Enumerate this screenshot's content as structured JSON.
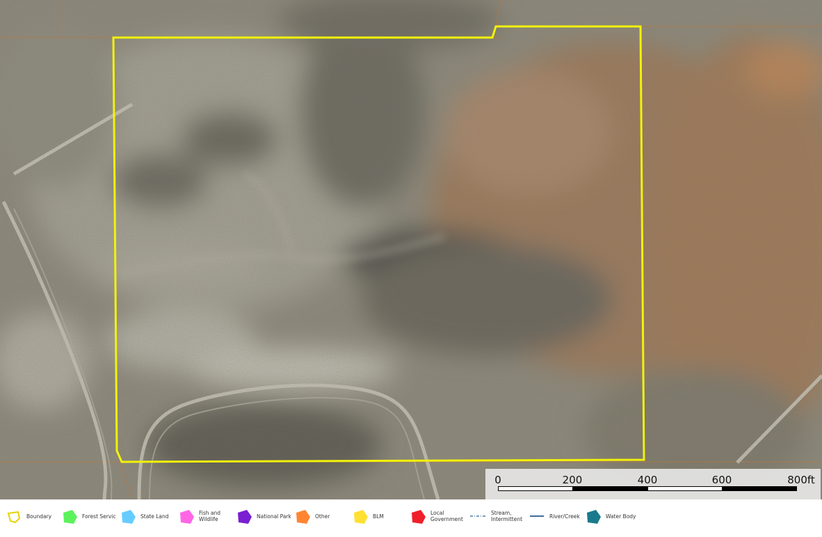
{
  "map": {
    "boundary_color": "#f2f20a",
    "parcel_line_color": "#c0793c"
  },
  "scale_bar": {
    "labels": [
      "0",
      "200",
      "400",
      "600",
      "800ft"
    ]
  },
  "legend": {
    "items": [
      {
        "label": "Boundary",
        "color": "#ffff00",
        "icon": "boundary-outline-icon"
      },
      {
        "label": "Forest Servic",
        "color": "#5bf25b",
        "icon": "forest-service-icon"
      },
      {
        "label": "State Land",
        "color": "#66ccff",
        "icon": "state-land-icon"
      },
      {
        "label": "Fish and\nWildlife",
        "color": "#ff66e6",
        "icon": "fish-wildlife-icon"
      },
      {
        "label": "National Park",
        "color": "#7a1fd1",
        "icon": "national-park-icon"
      },
      {
        "label": "Other",
        "color": "#ff8533",
        "icon": "other-land-icon"
      },
      {
        "label": "BLM",
        "color": "#ffe033",
        "icon": "blm-icon"
      },
      {
        "label": "Local\nGovernment",
        "color": "#f0202a",
        "icon": "local-government-icon"
      },
      {
        "label": "Stream,\nIntermittent",
        "color": "#4a7fa8",
        "icon": "stream-intermittent-icon"
      },
      {
        "label": "River/Creek",
        "color": "#3f6f9a",
        "icon": "river-creek-icon"
      },
      {
        "label": "Water Body",
        "color": "#1a7a8c",
        "icon": "water-body-icon"
      }
    ]
  }
}
